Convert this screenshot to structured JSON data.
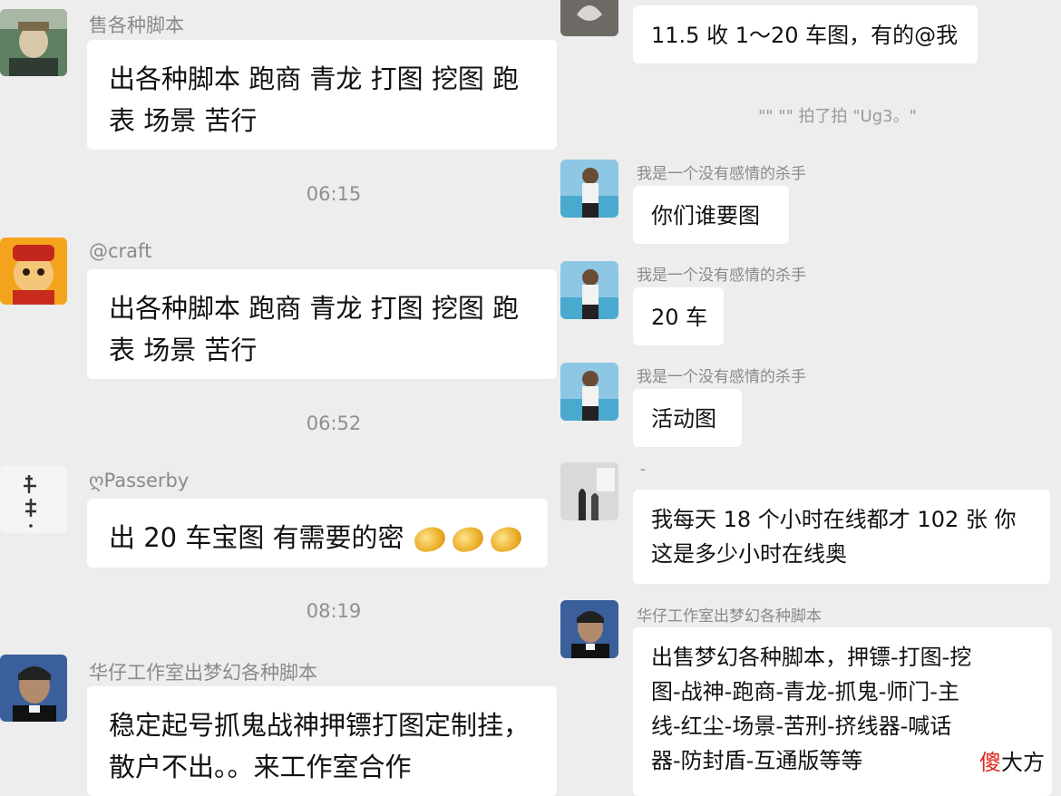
{
  "left_chat": {
    "messages": [
      {
        "sender": "售各种脚本",
        "text": "出各种脚本 跑商 青龙 打图 挖图 跑\n表 场景 苦行"
      },
      {
        "time": "06:15"
      },
      {
        "sender": "@craft",
        "text": "出各种脚本 跑商 青龙 打图 挖图 跑\n表 场景 苦行"
      },
      {
        "time": "06:52"
      },
      {
        "sender": "ღPasserby",
        "text": "出 20 车宝图 有需要的密",
        "emoji": "gold-ingot-icon"
      },
      {
        "time": "08:19"
      },
      {
        "sender": "华仔工作室出梦幻各种脚本",
        "text": "稳定起号抓鬼战神押镖打图定制挂，\n散户不出。。来工作室合作"
      }
    ]
  },
  "right_chat": {
    "messages": [
      {
        "text": "11.5 收 1～20 车图，有的@我"
      },
      {
        "system": "\"\" \"\" 拍了拍 \"Ug3。\""
      },
      {
        "sender": "我是一个没有感情的杀手",
        "text": "你们谁要图"
      },
      {
        "sender": "我是一个没有感情的杀手",
        "text": "20 车"
      },
      {
        "sender": "我是一个没有感情的杀手",
        "text": "活动图"
      },
      {
        "sender": "-",
        "text": "我每天 18 个小时在线都才 102 张 你\n这是多少小时在线奥"
      },
      {
        "sender": "华仔工作室出梦幻各种脚本",
        "text": "出售梦幻各种脚本，押镖-打图-挖\n图-战神-跑商-青龙-抓鬼-师门-主\n线-红尘-场景-苦刑-挤线器-喊话\n器-防封盾-互通版等等"
      }
    ]
  },
  "watermark": {
    "red": "傻",
    "black": "大方"
  }
}
